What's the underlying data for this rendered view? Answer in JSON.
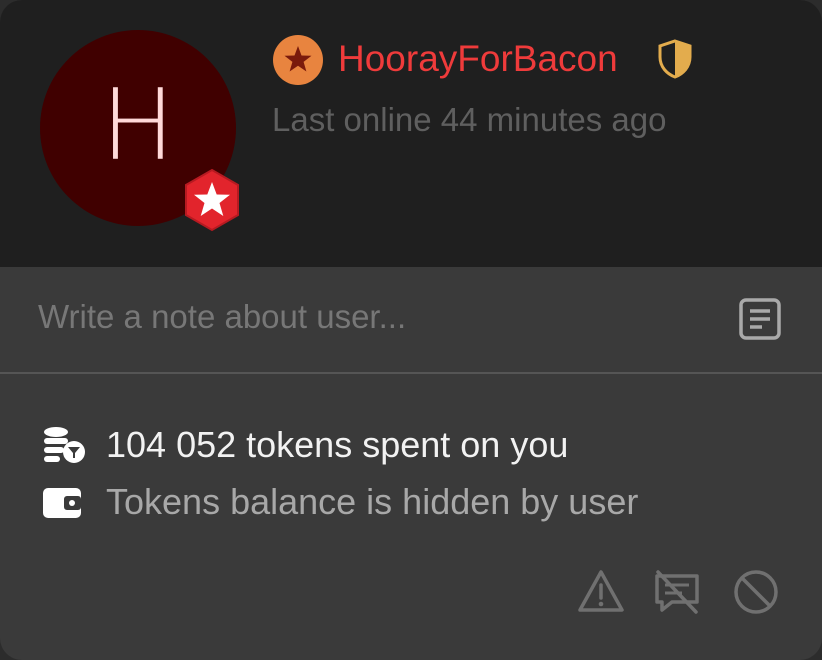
{
  "profile": {
    "avatar_letter": "H",
    "username": "HoorayForBacon",
    "last_online": "Last online 44 minutes ago",
    "avatar_color": "#400000",
    "username_color": "#ef3b3b"
  },
  "icons": {
    "rank": "star-badge-icon",
    "shield": "shield-icon",
    "avatar_badge": "star-hexagon-icon",
    "note": "note-icon",
    "tokens": "coins-icon",
    "wallet": "wallet-icon",
    "report": "warning-icon",
    "mute": "chat-off-icon",
    "block": "block-icon"
  },
  "note": {
    "placeholder": "Write a note about user..."
  },
  "stats": {
    "tokens_spent": "104 052 tokens spent on you",
    "balance": "Tokens balance is hidden by user"
  }
}
